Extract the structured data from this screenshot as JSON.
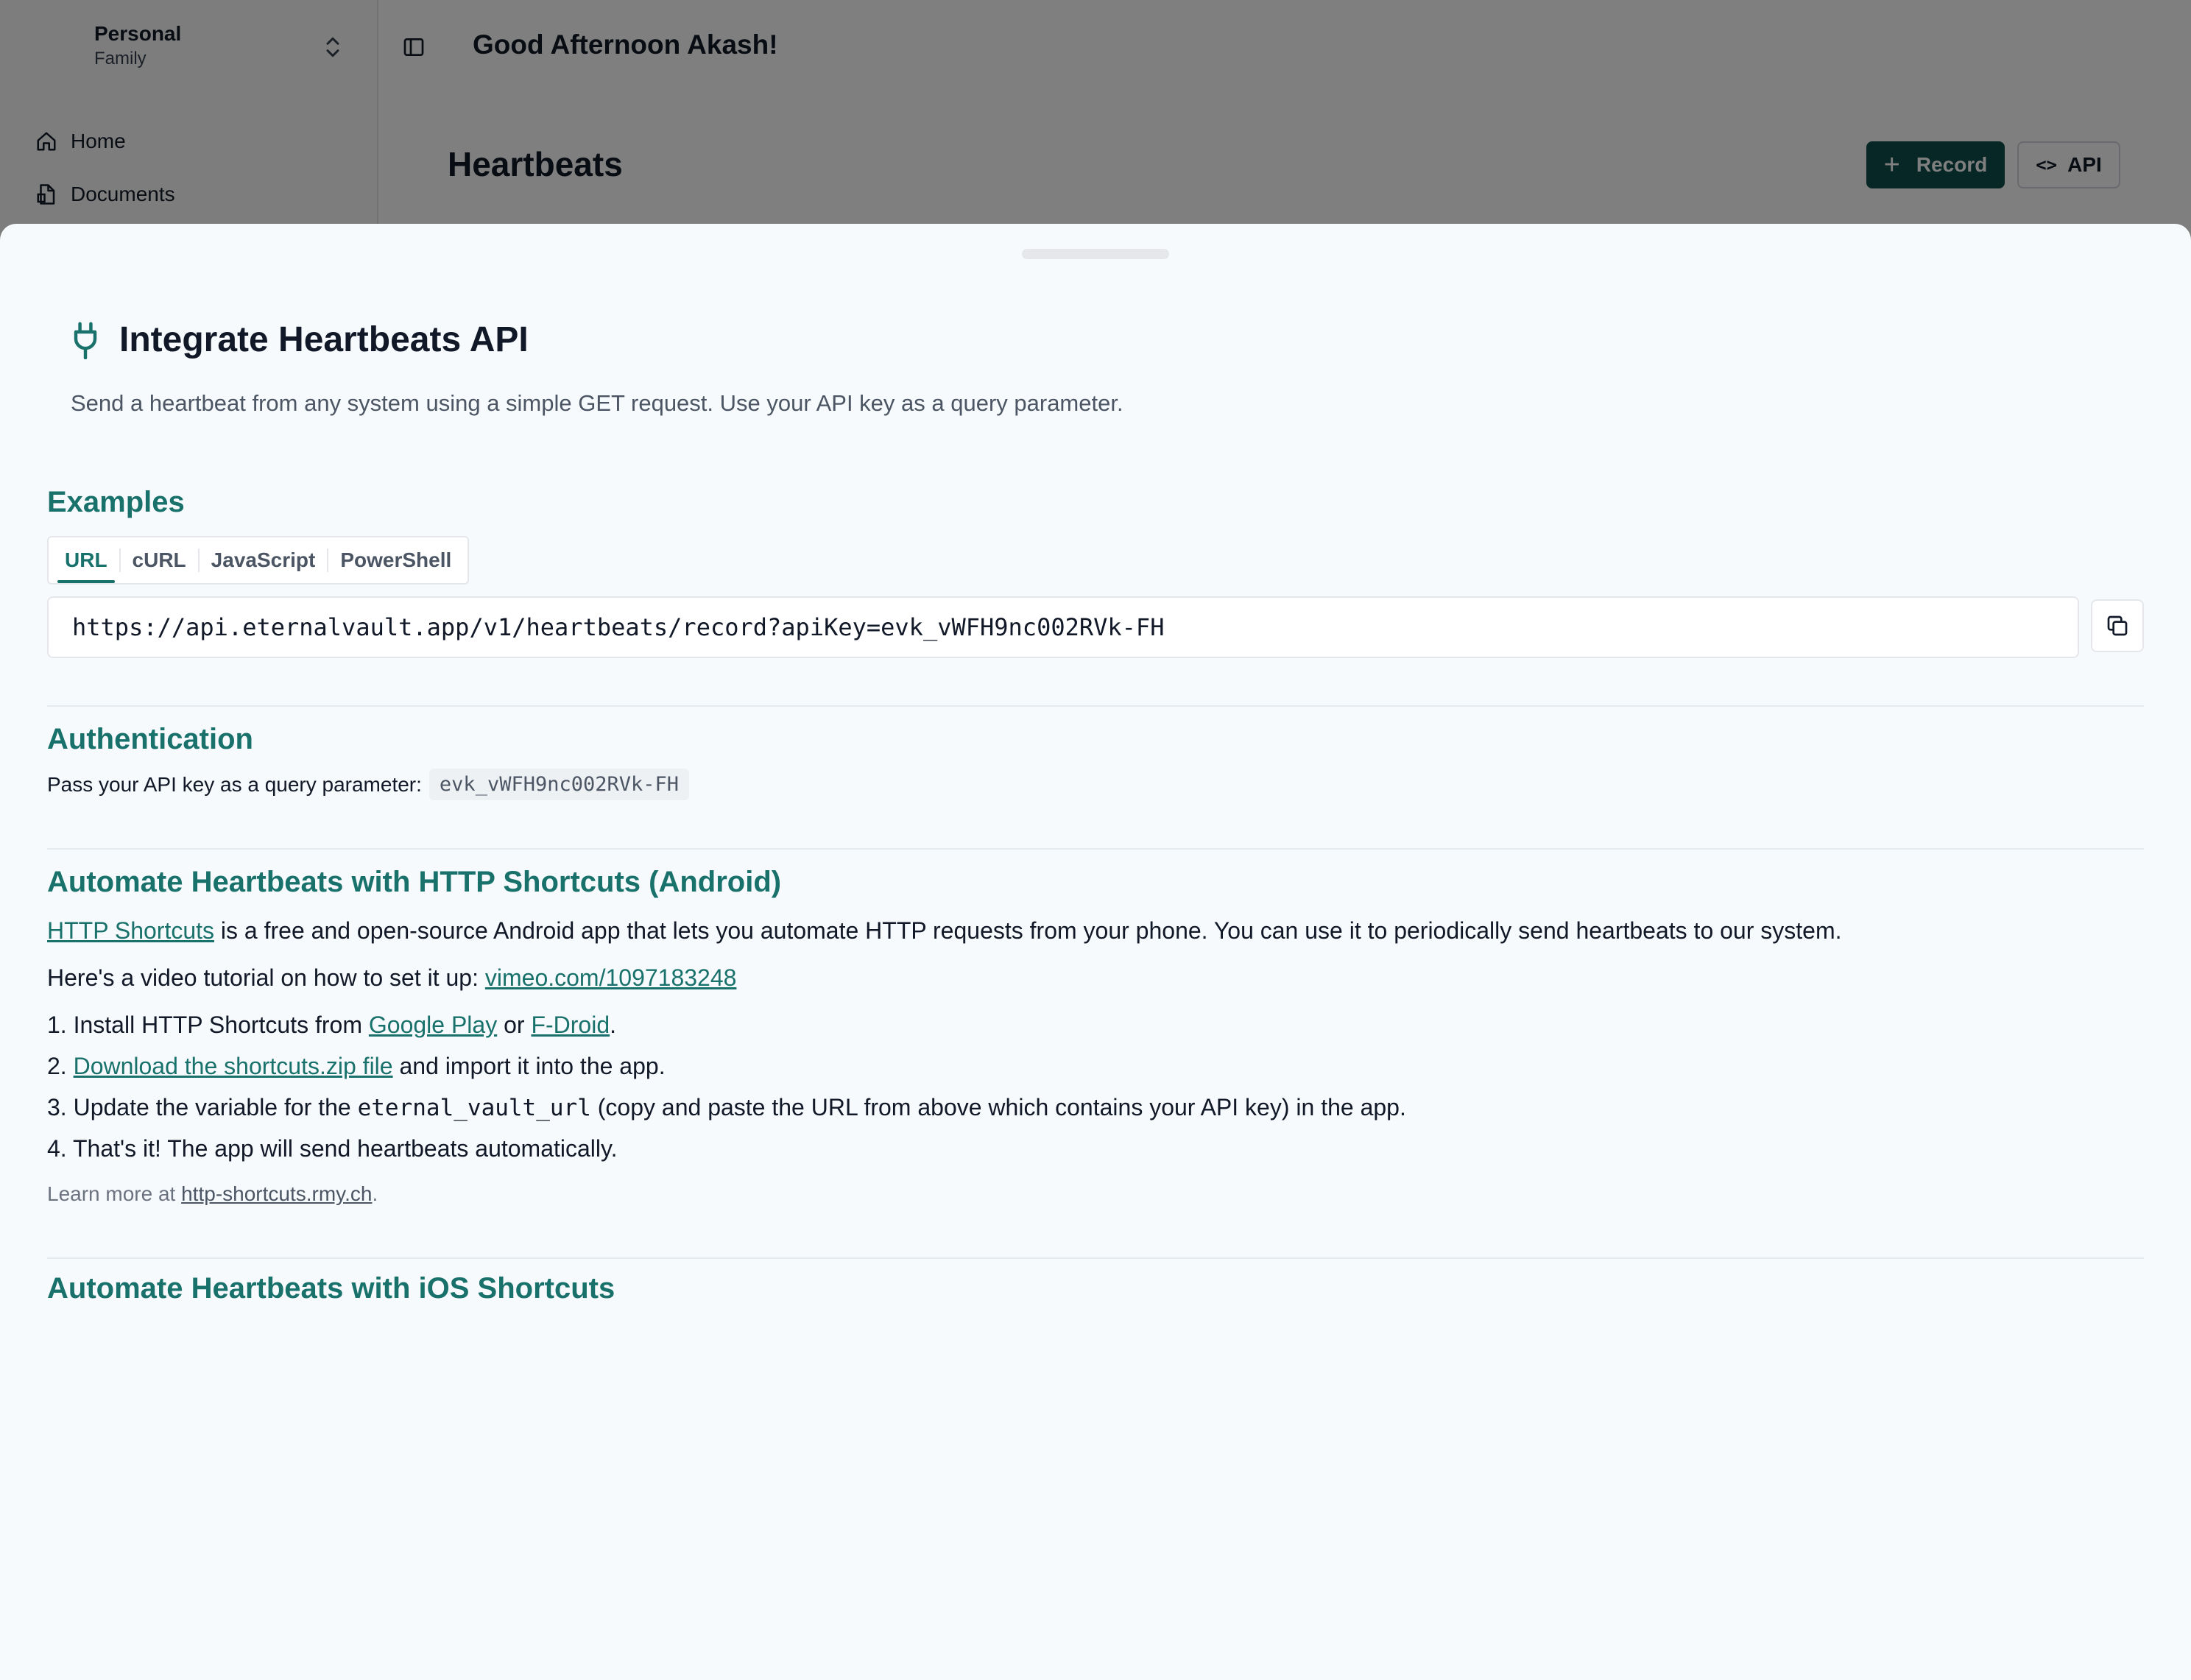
{
  "app": {
    "workspace": {
      "name": "Personal",
      "subtitle": "Family"
    },
    "nav": [
      {
        "label": "Home",
        "icon": "home-icon"
      },
      {
        "label": "Documents",
        "icon": "document-icon"
      }
    ],
    "greeting": "Good Afternoon Akash!",
    "page_title": "Heartbeats",
    "record_button": "Record",
    "api_button": "API"
  },
  "drawer": {
    "title": "Integrate Heartbeats API",
    "description": "Send a heartbeat from any system using a simple GET request. Use your API key as a query parameter.",
    "examples": {
      "heading": "Examples",
      "tabs": [
        "URL",
        "cURL",
        "JavaScript",
        "PowerShell"
      ],
      "selected_tab": "URL",
      "url": "https://api.eternalvault.app/v1/heartbeats/record?apiKey=evk_vWFH9nc002RVk-FH"
    },
    "auth": {
      "heading": "Authentication",
      "text": "Pass your API key as a query parameter:",
      "api_key": "evk_vWFH9nc002RVk-FH"
    },
    "android": {
      "heading": "Automate Heartbeats with HTTP Shortcuts (Android)",
      "intro_link": "HTTP Shortcuts",
      "intro_text": " is a free and open-source Android app that lets you automate HTTP requests from your phone. You can use it to periodically send heartbeats to our system.",
      "video_text": "Here's a video tutorial on how to set it up: ",
      "video_link": "vimeo.com/1097183248",
      "step1_prefix": "1. Install HTTP Shortcuts from ",
      "step1_link1": "Google Play",
      "step1_mid": " or ",
      "step1_link2": "F-Droid",
      "step1_end": ".",
      "step2_prefix": "2. ",
      "step2_link": "Download the shortcuts.zip file",
      "step2_text": " and import it into the app.",
      "step3_prefix": "3. Update the variable for the ",
      "step3_code": "eternal_vault_url",
      "step3_text": " (copy and paste the URL from above which contains your API key) in the app.",
      "step4": "4. That's it! The app will send heartbeats automatically.",
      "learn_prefix": "Learn more at ",
      "learn_link": "http-shortcuts.rmy.ch",
      "learn_end": "."
    },
    "ios": {
      "heading": "Automate Heartbeats with iOS Shortcuts"
    }
  },
  "colors": {
    "accent": "#18716b",
    "primary_button": "#0f4c4c",
    "sheet_bg": "#f7fafc"
  }
}
